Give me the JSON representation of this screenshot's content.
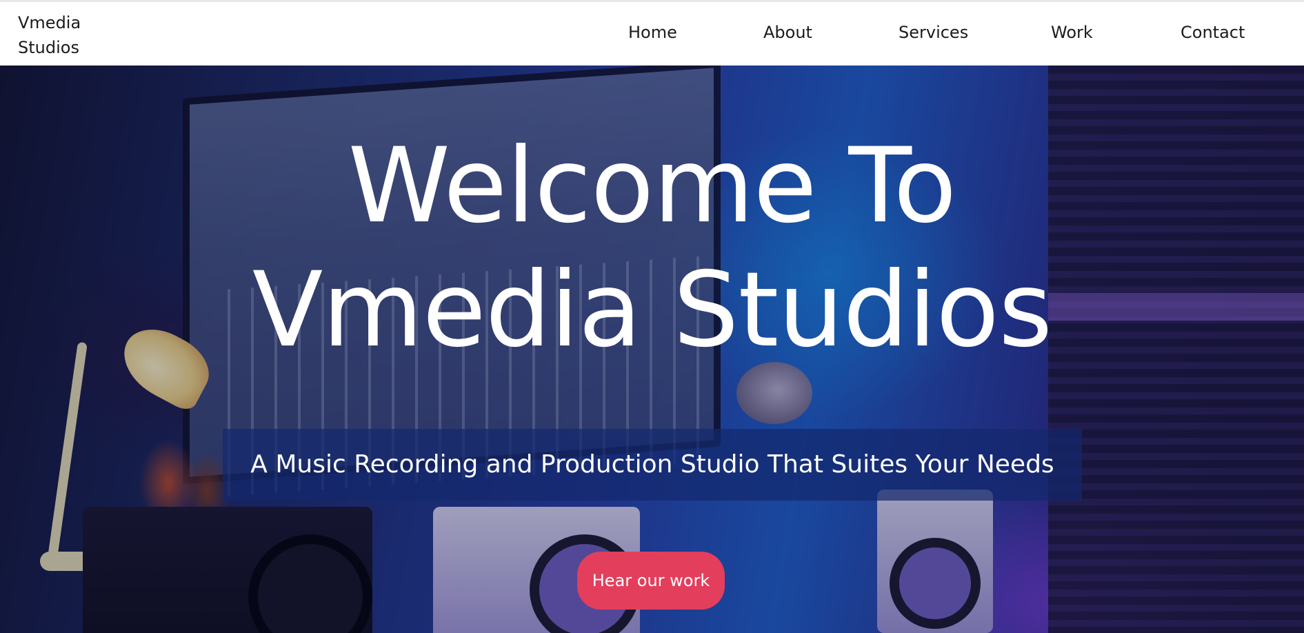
{
  "brand": {
    "line1": "Vmedia",
    "line2": "Studios"
  },
  "nav": {
    "items": [
      {
        "label": "Home"
      },
      {
        "label": "About"
      },
      {
        "label": "Services"
      },
      {
        "label": "Work"
      },
      {
        "label": "Contact"
      }
    ]
  },
  "hero": {
    "title_line1": "Welcome To",
    "title_line2": "Vmedia Studios",
    "tagline": "A Music Recording and Production Studio That Suites Your Needs",
    "cta_label": "Hear our work"
  },
  "colors": {
    "accent": "#e33e5c",
    "nav_text": "#1b1b1b",
    "tagline_box": "#14286e"
  }
}
